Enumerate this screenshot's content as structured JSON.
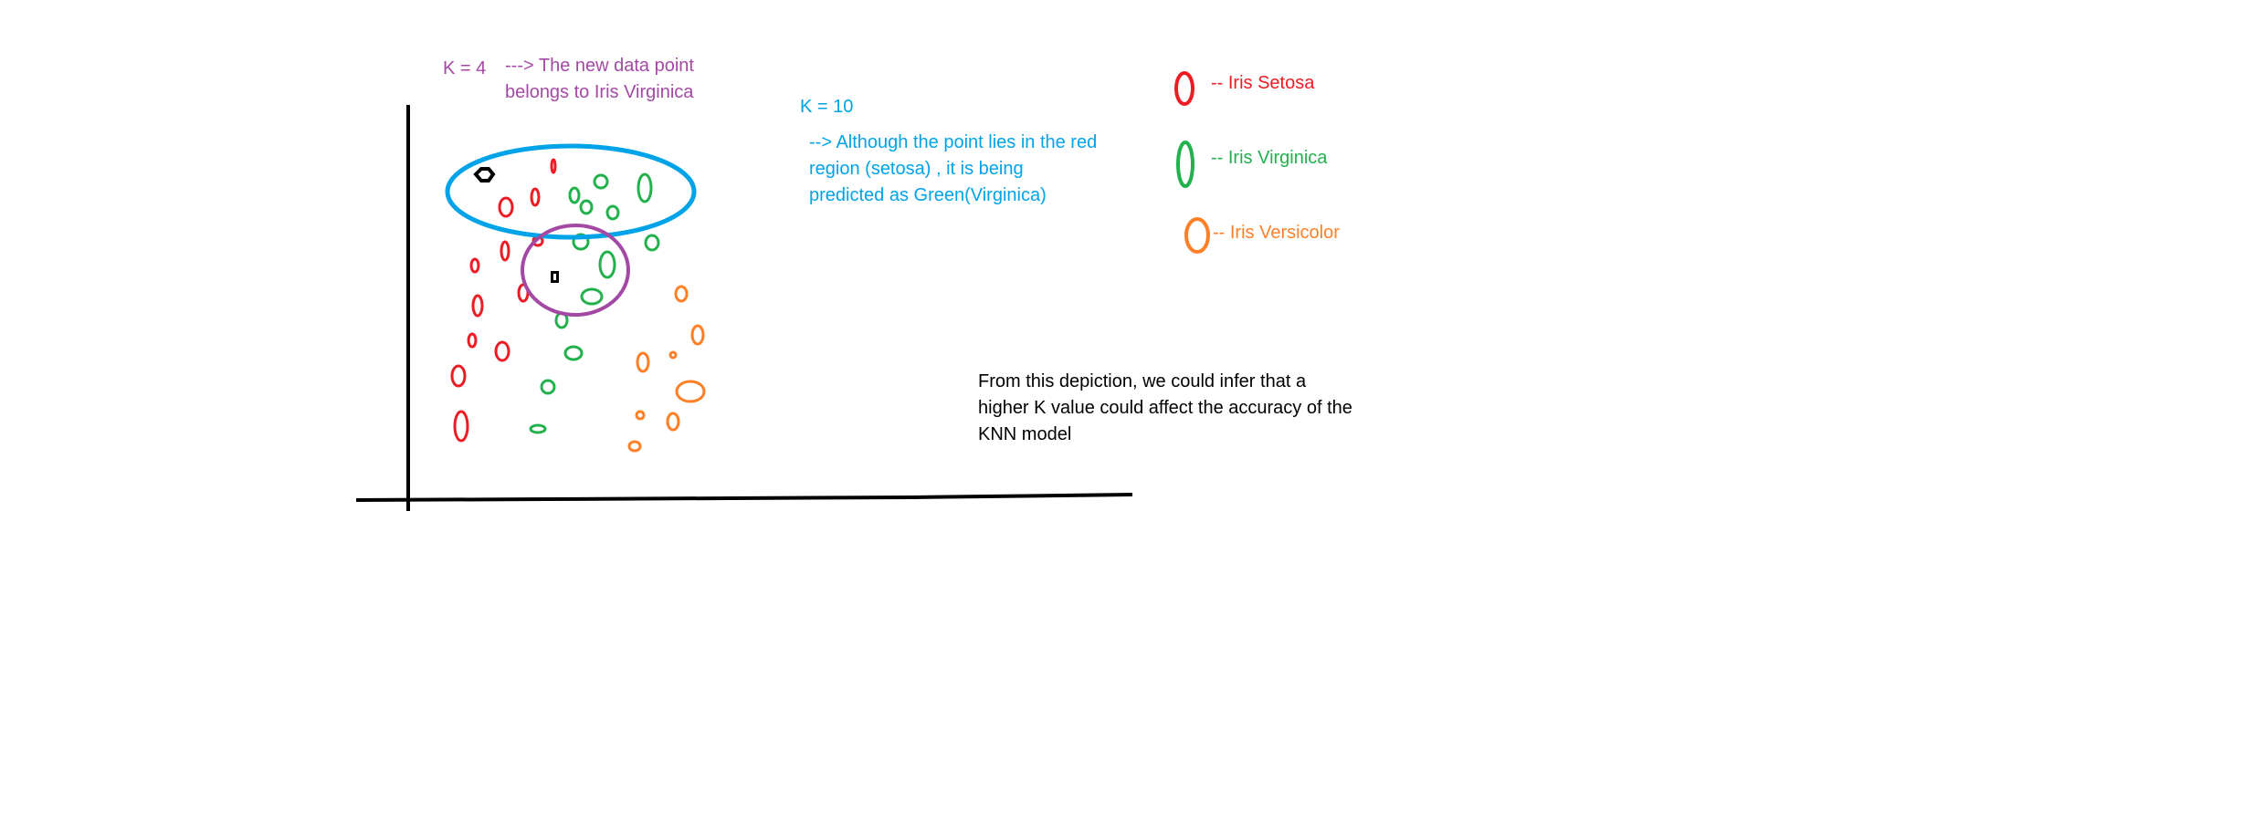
{
  "colors": {
    "setosa": "#ed1c24",
    "virginica": "#22b14c",
    "versicolor": "#ff7f27",
    "k4": "#a349a4",
    "k10": "#00a2e8",
    "axis": "#000000"
  },
  "annotations": {
    "k4_label": "K = 4",
    "k4_note_line1": "---> The new data point",
    "k4_note_line2": "belongs to Iris Virginica",
    "k10_label": "K = 10",
    "k10_note_line1": "--> Although the point lies in the red",
    "k10_note_line2": "region (setosa) , it is being",
    "k10_note_line3": "predicted as Green(Virginica)",
    "conclusion_line1": "From this depiction, we could infer that a",
    "conclusion_line2": "higher K value could affect the accuracy of the",
    "conclusion_line3": "KNN model"
  },
  "legend": {
    "setosa": "-- Iris Setosa",
    "virginica": "-- Iris Virginica",
    "versicolor": "-- Iris Versicolor"
  }
}
